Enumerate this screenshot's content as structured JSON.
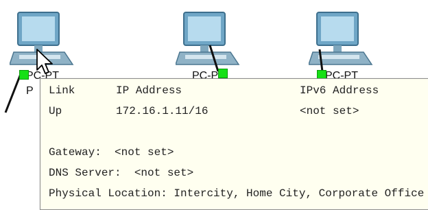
{
  "devices": [
    {
      "label": "PC-PT",
      "icon": "pc-icon"
    },
    {
      "label": "PC-PT",
      "icon": "pc-icon"
    },
    {
      "label": "PC-PT",
      "icon": "pc-icon"
    }
  ],
  "partial_label": "P",
  "tooltip": {
    "headers": {
      "link": "Link",
      "ip": "IP Address",
      "ipv6": "IPv6 Address"
    },
    "row": {
      "link": "Up",
      "ip": "172.16.1.11/16",
      "ipv6": "<not set>"
    },
    "gateway": "Gateway:  <not set>",
    "dns": "DNS Server:  <not set>",
    "location": "Physical Location: Intercity, Home City, Corporate Office"
  },
  "colors": {
    "link_up": "#16e016",
    "tooltip_bg": "#fffff0"
  }
}
